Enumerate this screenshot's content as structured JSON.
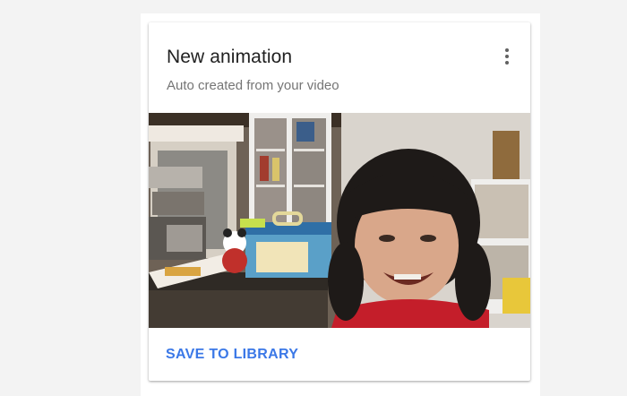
{
  "card": {
    "title": "New animation",
    "subtitle": "Auto created from your video",
    "menu_icon": "more-vert-icon",
    "action_label": "SAVE TO LIBRARY"
  },
  "colors": {
    "accent": "#3b78e7",
    "title": "#212121",
    "subtitle": "#757575"
  }
}
